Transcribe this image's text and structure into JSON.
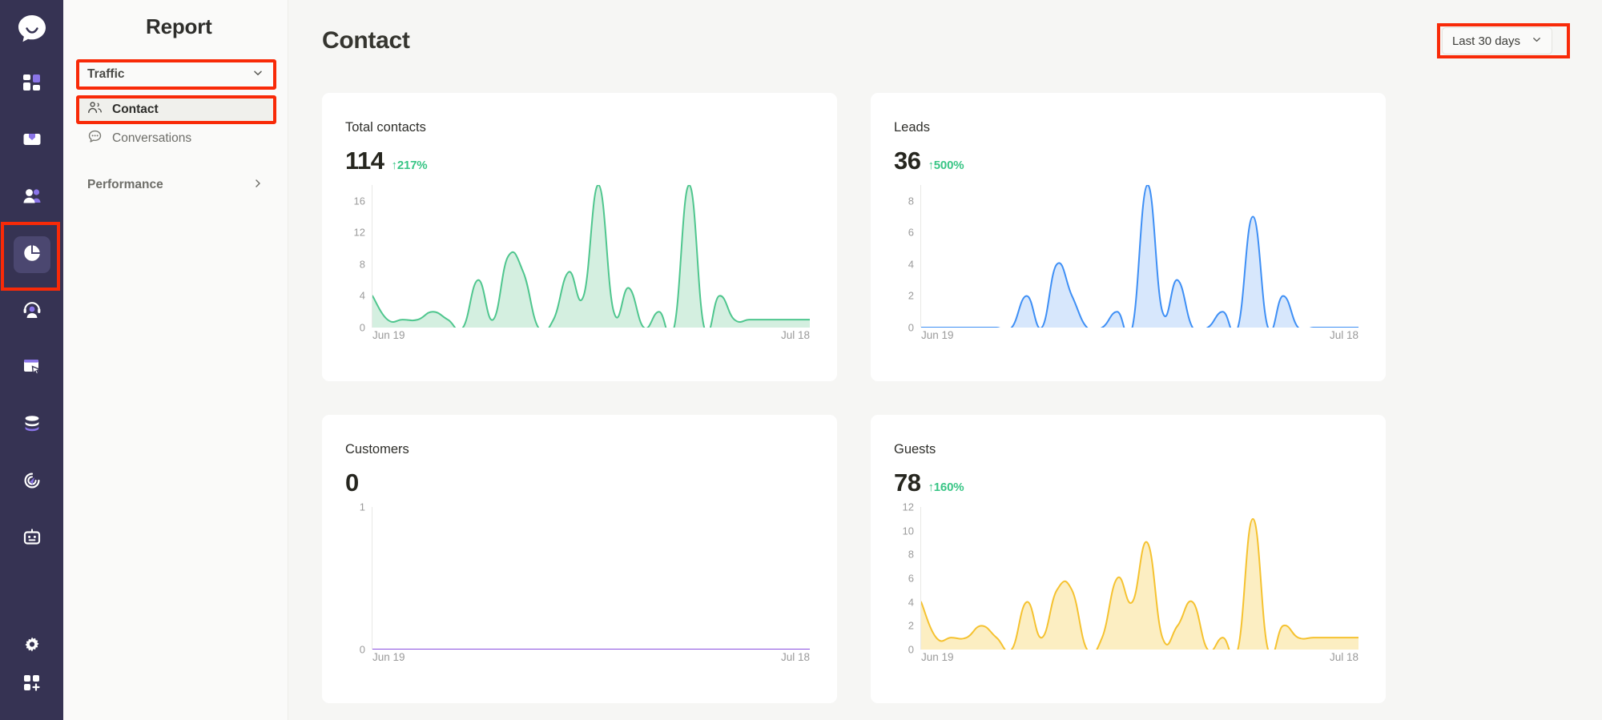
{
  "rail": {
    "logo_icon": "chat-bubble-logo-icon",
    "items": [
      {
        "icon": "dashboard-grid-icon",
        "active": false
      },
      {
        "icon": "inbox-icon",
        "active": false
      },
      {
        "icon": "contacts-people-icon",
        "active": false
      },
      {
        "icon": "pie-chart-report-icon",
        "active": true
      },
      {
        "icon": "headset-agent-icon",
        "active": false
      },
      {
        "icon": "campaign-window-click-icon",
        "active": false
      },
      {
        "icon": "database-stack-icon",
        "active": false
      },
      {
        "icon": "automation-rocket-icon",
        "active": false
      },
      {
        "icon": "chatbot-icon",
        "active": false
      }
    ],
    "bottom_items": [
      {
        "icon": "gear-settings-icon",
        "active": false
      },
      {
        "icon": "apps-add-grid-icon",
        "active": false
      }
    ]
  },
  "sidebar": {
    "title": "Report",
    "select": {
      "label": "Traffic",
      "chevron_icon": "chevron-down-icon"
    },
    "items": [
      {
        "label": "Contact",
        "icon": "people-icon",
        "selected": true
      },
      {
        "label": "Conversations",
        "icon": "chat-dots-icon",
        "selected": false
      }
    ],
    "group": {
      "label": "Performance",
      "chevron_icon": "chevron-right-icon"
    }
  },
  "header": {
    "title": "Contact",
    "date_range": {
      "label": "Last 30 days",
      "chevron_icon": "chevron-down-icon"
    }
  },
  "colors": {
    "rail_bg": "#363353",
    "rail_active": "#4B4770",
    "accent_purple": "#8A74E8",
    "positive_green": "#38C585",
    "annotation_red": "#F82A08",
    "contacts_stroke": "#4FC68E",
    "contacts_fill": "#D4EFE0",
    "leads_stroke": "#3E8FF5",
    "leads_fill": "#D7E7FC",
    "customers_stroke": "#8A4FE0",
    "guests_stroke": "#F5C230",
    "guests_fill": "#FCEEC2"
  },
  "cards": [
    {
      "title": "Total contacts",
      "value": "114",
      "delta": "↑217%",
      "delta_direction": "up"
    },
    {
      "title": "Leads",
      "value": "36",
      "delta": "↑500%",
      "delta_direction": "up"
    },
    {
      "title": "Customers",
      "value": "0",
      "delta": "",
      "delta_direction": "none"
    },
    {
      "title": "Guests",
      "value": "78",
      "delta": "↑160%",
      "delta_direction": "up"
    }
  ],
  "chart_data": [
    {
      "type": "area",
      "title": "Total contacts",
      "xlabel": "",
      "ylabel": "",
      "x": [
        "Jun 19",
        "Jun 20",
        "Jun 21",
        "Jun 22",
        "Jun 23",
        "Jun 24",
        "Jun 25",
        "Jun 26",
        "Jun 27",
        "Jun 28",
        "Jun 29",
        "Jun 30",
        "Jul 1",
        "Jul 2",
        "Jul 3",
        "Jul 4",
        "Jul 5",
        "Jul 6",
        "Jul 7",
        "Jul 8",
        "Jul 9",
        "Jul 10",
        "Jul 11",
        "Jul 12",
        "Jul 13",
        "Jul 14",
        "Jul 15",
        "Jul 16",
        "Jul 17",
        "Jul 18"
      ],
      "tick_labels_shown": [
        "Jun 19",
        "Jul 18"
      ],
      "values": [
        4,
        1,
        1,
        1,
        2,
        1,
        0,
        6,
        1,
        9,
        7,
        0,
        1,
        7,
        4,
        18,
        2,
        5,
        0,
        2,
        0,
        18,
        0,
        4,
        1,
        1,
        1,
        1,
        1,
        1
      ],
      "yticks": [
        0,
        4,
        8,
        12,
        16
      ],
      "ylim": [
        0,
        18
      ],
      "grid": false,
      "stroke": "#4FC68E",
      "fill": "#D4EFE0",
      "smoothing": "spline"
    },
    {
      "type": "area",
      "title": "Leads",
      "xlabel": "",
      "ylabel": "",
      "x": [
        "Jun 19",
        "Jun 20",
        "Jun 21",
        "Jun 22",
        "Jun 23",
        "Jun 24",
        "Jun 25",
        "Jun 26",
        "Jun 27",
        "Jun 28",
        "Jun 29",
        "Jun 30",
        "Jul 1",
        "Jul 2",
        "Jul 3",
        "Jul 4",
        "Jul 5",
        "Jul 6",
        "Jul 7",
        "Jul 8",
        "Jul 9",
        "Jul 10",
        "Jul 11",
        "Jul 12",
        "Jul 13",
        "Jul 14",
        "Jul 15",
        "Jul 16",
        "Jul 17",
        "Jul 18"
      ],
      "tick_labels_shown": [
        "Jun 19",
        "Jul 18"
      ],
      "values": [
        0,
        0,
        0,
        0,
        0,
        0,
        0,
        2,
        0,
        4,
        2,
        0,
        0,
        1,
        0,
        9,
        1,
        3,
        0,
        0,
        1,
        0,
        7,
        0,
        2,
        0,
        0,
        0,
        0,
        0
      ],
      "yticks": [
        0,
        2,
        4,
        6,
        8
      ],
      "ylim": [
        0,
        9
      ],
      "grid": false,
      "stroke": "#3E8FF5",
      "fill": "#D7E7FC",
      "smoothing": "spline"
    },
    {
      "type": "line",
      "title": "Customers",
      "xlabel": "",
      "ylabel": "",
      "x": [
        "Jun 19",
        "Jun 20",
        "Jun 21",
        "Jun 22",
        "Jun 23",
        "Jun 24",
        "Jun 25",
        "Jun 26",
        "Jun 27",
        "Jun 28",
        "Jun 29",
        "Jun 30",
        "Jul 1",
        "Jul 2",
        "Jul 3",
        "Jul 4",
        "Jul 5",
        "Jul 6",
        "Jul 7",
        "Jul 8",
        "Jul 9",
        "Jul 10",
        "Jul 11",
        "Jul 12",
        "Jul 13",
        "Jul 14",
        "Jul 15",
        "Jul 16",
        "Jul 17",
        "Jul 18"
      ],
      "tick_labels_shown": [
        "Jun 19",
        "Jul 18"
      ],
      "values": [
        0,
        0,
        0,
        0,
        0,
        0,
        0,
        0,
        0,
        0,
        0,
        0,
        0,
        0,
        0,
        0,
        0,
        0,
        0,
        0,
        0,
        0,
        0,
        0,
        0,
        0,
        0,
        0,
        0,
        0
      ],
      "yticks": [
        0,
        1
      ],
      "ylim": [
        0,
        1
      ],
      "grid": false,
      "stroke": "#8A4FE0",
      "fill": "none",
      "smoothing": "linear"
    },
    {
      "type": "area",
      "title": "Guests",
      "xlabel": "",
      "ylabel": "",
      "x": [
        "Jun 19",
        "Jun 20",
        "Jun 21",
        "Jun 22",
        "Jun 23",
        "Jun 24",
        "Jun 25",
        "Jun 26",
        "Jun 27",
        "Jun 28",
        "Jun 29",
        "Jun 30",
        "Jul 1",
        "Jul 2",
        "Jul 3",
        "Jul 4",
        "Jul 5",
        "Jul 6",
        "Jul 7",
        "Jul 8",
        "Jul 9",
        "Jul 10",
        "Jul 11",
        "Jul 12",
        "Jul 13",
        "Jul 14",
        "Jul 15",
        "Jul 16",
        "Jul 17",
        "Jul 18"
      ],
      "tick_labels_shown": [
        "Jun 19",
        "Jul 18"
      ],
      "values": [
        4,
        1,
        1,
        1,
        2,
        1,
        0,
        4,
        1,
        5,
        5,
        0,
        1,
        6,
        4,
        9,
        1,
        2,
        4,
        0,
        1,
        0,
        11,
        0,
        2,
        1,
        1,
        1,
        1,
        1
      ],
      "yticks": [
        0,
        2,
        4,
        6,
        8,
        10,
        12
      ],
      "ylim": [
        0,
        12
      ],
      "grid": false,
      "stroke": "#F5C230",
      "fill": "#FCEEC2",
      "smoothing": "spline"
    }
  ]
}
